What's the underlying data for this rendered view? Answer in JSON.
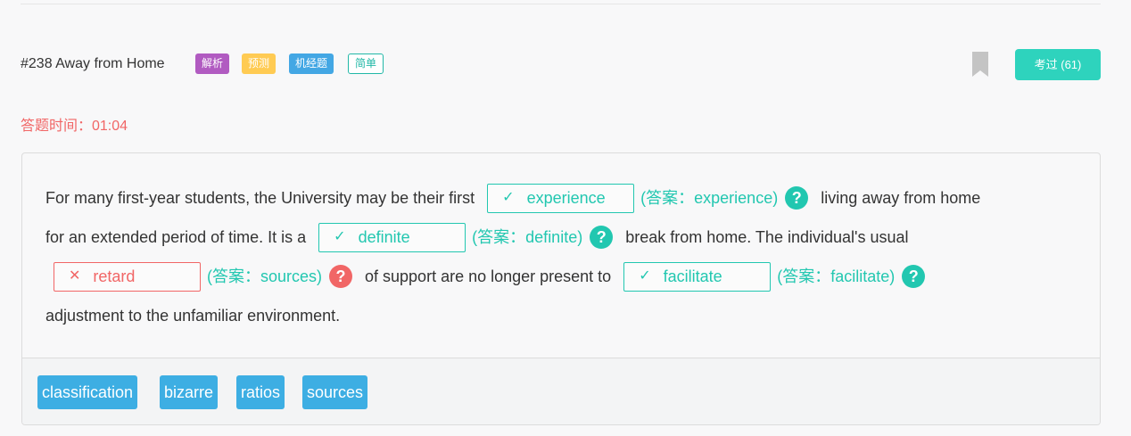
{
  "header": {
    "question_title": "#238 Away from Home",
    "tags": {
      "analysis": "解析",
      "predict": "预测",
      "machine": "机经题",
      "easy": "简单"
    },
    "passed_button": "考过 (61)"
  },
  "timer": "答题时间：01:04",
  "passage": {
    "l1_before": "For many first-year students, the University may be their first",
    "blank1": {
      "mark": "✓",
      "value": "experience",
      "answer": "(答案：experience)"
    },
    "l1_after": "living away from home",
    "l2_before": "for an extended period of time. It is a",
    "blank2": {
      "mark": "✓",
      "value": "definite",
      "answer": "(答案：definite)"
    },
    "l2_after": "break from home. The individual's usual",
    "blank3": {
      "mark": "✕",
      "value": "retard",
      "answer": "(答案：sources)"
    },
    "l3_mid": "of support are no longer present to",
    "blank4": {
      "mark": "✓",
      "value": "facilitate",
      "answer": "(答案：facilitate)"
    },
    "l4": "adjustment to the unfamiliar environment.",
    "help_symbol": "?"
  },
  "word_bank": [
    "classification",
    "bizarre",
    "ratios",
    "sources"
  ],
  "colors": {
    "correct": "#22c7b0",
    "wrong": "#f16666",
    "word_chip": "#3daee3",
    "passed": "#2ed3bd"
  }
}
